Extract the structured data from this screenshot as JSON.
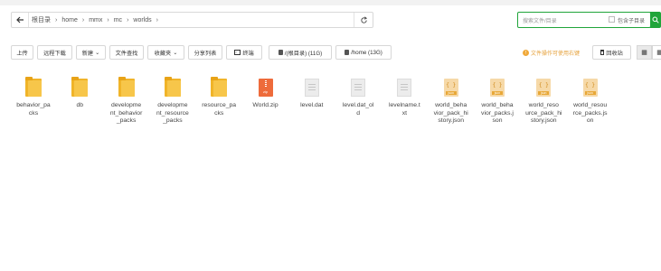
{
  "breadcrumb": [
    "根目录",
    "home",
    "mmx",
    "mc",
    "worlds"
  ],
  "search": {
    "placeholder": "搜索文件/目录",
    "subdir_label": "包含子目录"
  },
  "toolbar": {
    "upload": "上传",
    "remote_download": "远程下载",
    "new": "新建",
    "file_search": "文件查找",
    "favorites": "收藏夹",
    "share_list": "分享列表",
    "terminal": "终端",
    "disk_root": "/(根目录) (11G)",
    "disk_home": "/home (13G)",
    "warning": "文件操作可使用右键",
    "recycle": "回收站"
  },
  "files": [
    {
      "name": "behavior_pa\ncks",
      "type": "folder"
    },
    {
      "name": "db",
      "type": "folder"
    },
    {
      "name": "developme\nnt_behavior\n_packs",
      "type": "folder"
    },
    {
      "name": "developme\nnt_resource\n_packs",
      "type": "folder"
    },
    {
      "name": "resource_pa\ncks",
      "type": "folder"
    },
    {
      "name": "World.zip",
      "type": "zip"
    },
    {
      "name": "level.dat",
      "type": "doc"
    },
    {
      "name": "level.dat_ol\nd",
      "type": "doc"
    },
    {
      "name": "levelname.t\nxt",
      "type": "doc"
    },
    {
      "name": "world_beha\nvior_pack_hi\nstory.json",
      "type": "json"
    },
    {
      "name": "world_beha\nvior_packs.j\nson",
      "type": "json"
    },
    {
      "name": "world_reso\nurce_pack_hi\nstory.json",
      "type": "json"
    },
    {
      "name": "world_resou\nrce_packs.js\non",
      "type": "json"
    }
  ]
}
